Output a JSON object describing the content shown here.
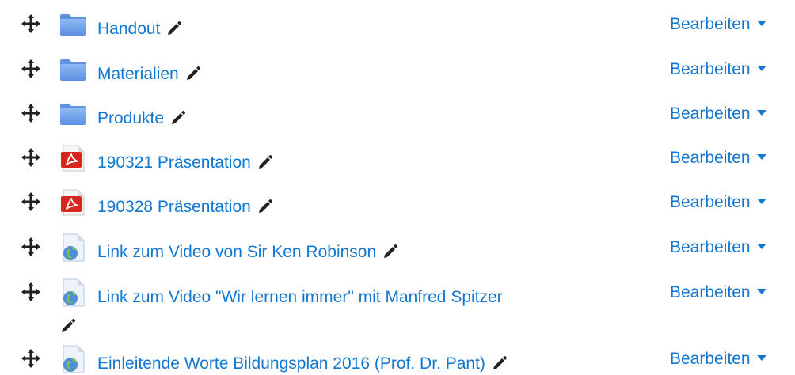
{
  "activities": [
    {
      "name": "Handout",
      "type": "folder",
      "icon": "folder-icon",
      "action_label": "Bearbeiten"
    },
    {
      "name": "Materialien",
      "type": "folder",
      "icon": "folder-icon",
      "action_label": "Bearbeiten"
    },
    {
      "name": "Produkte",
      "type": "folder",
      "icon": "folder-icon",
      "action_label": "Bearbeiten"
    },
    {
      "name": "190321 Präsentation",
      "type": "pdf",
      "icon": "pdf-icon",
      "action_label": "Bearbeiten"
    },
    {
      "name": "190328 Präsentation",
      "type": "pdf",
      "icon": "pdf-icon",
      "action_label": "Bearbeiten"
    },
    {
      "name": "Link zum Video von Sir Ken Robinson",
      "type": "url",
      "icon": "url-link-icon",
      "action_label": "Bearbeiten"
    },
    {
      "name": "Link zum Video \"Wir lernen immer\" mit Manfred Spitzer",
      "type": "url",
      "icon": "url-link-icon",
      "action_label": "Bearbeiten"
    },
    {
      "name": "Einleitende Worte Bildungsplan 2016 (Prof. Dr. Pant)",
      "type": "url",
      "icon": "url-link-icon",
      "action_label": "Bearbeiten"
    }
  ],
  "colors": {
    "link": "#1177d1",
    "folder": "#6b9fea",
    "pdf": "#d7261e",
    "icon_dark": "#222222"
  }
}
